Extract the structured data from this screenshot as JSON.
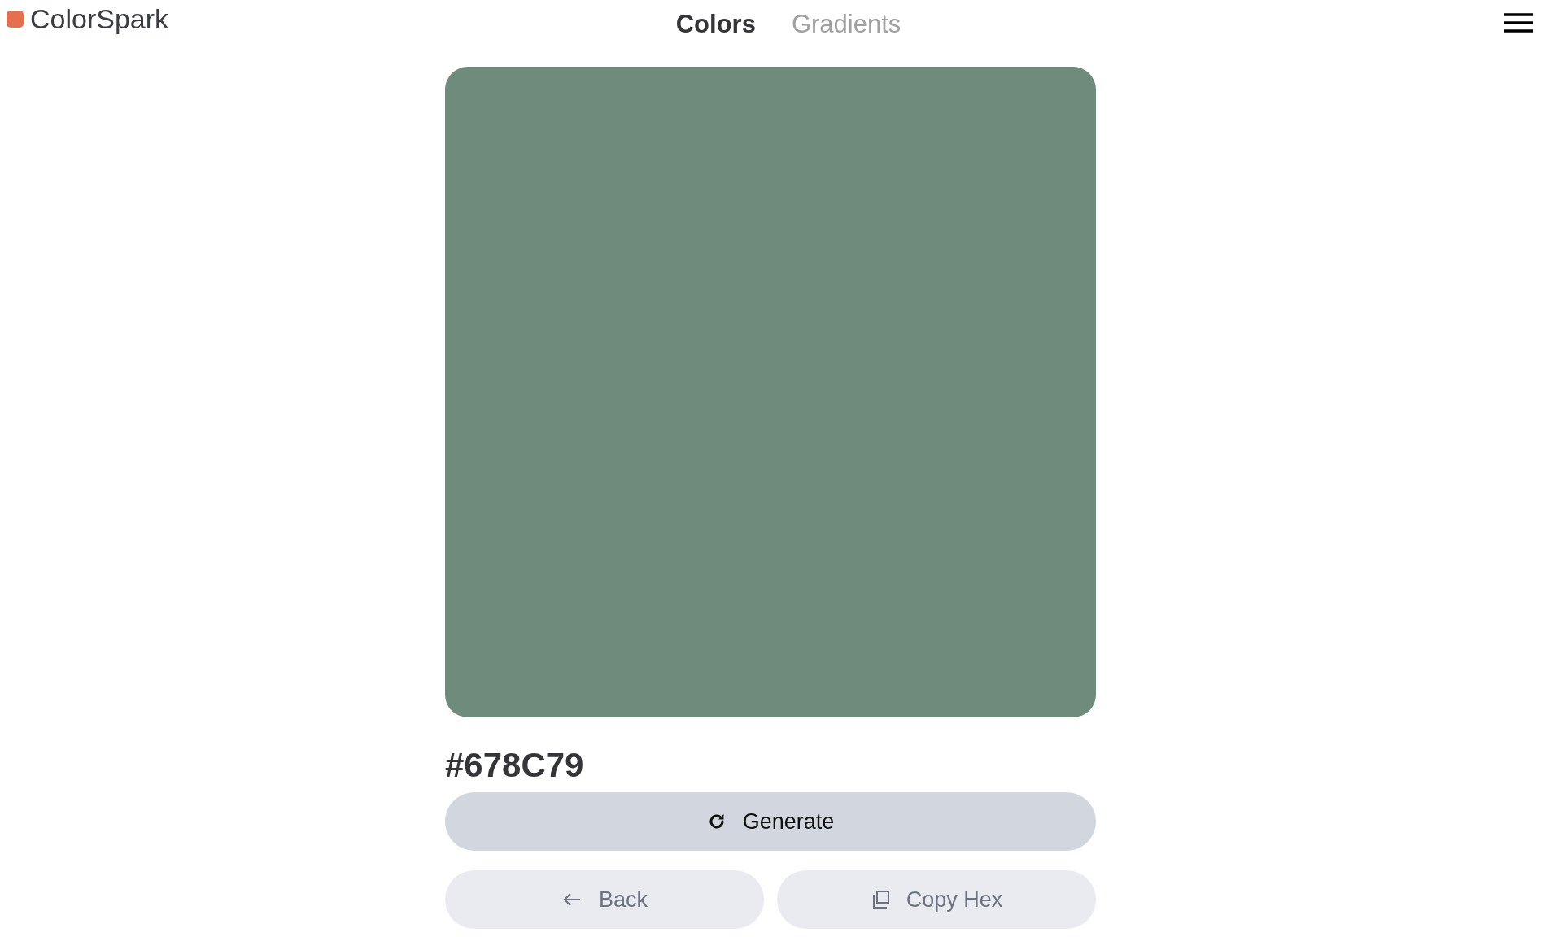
{
  "brand": {
    "name": "ColorSpark",
    "color": "#e5704f"
  },
  "nav": [
    {
      "label": "Colors",
      "selected": true
    },
    {
      "label": "Gradients",
      "selected": false
    }
  ],
  "swatch": {
    "color": "#6f8b7b"
  },
  "hex": "#678C79",
  "buttons": [
    {
      "kind": "generate",
      "label": "Generate"
    },
    {
      "kind": "back",
      "label": "Back"
    },
    {
      "kind": "copy",
      "label": "Copy Hex"
    }
  ]
}
